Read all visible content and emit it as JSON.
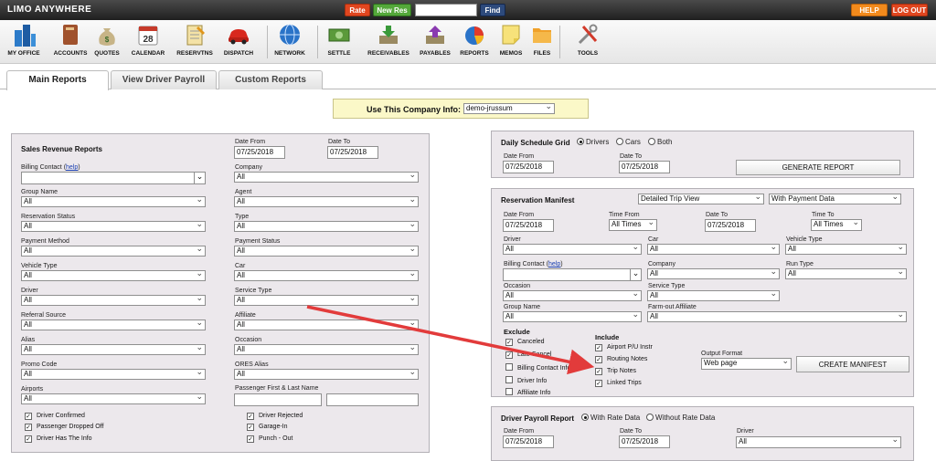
{
  "app": {
    "logo": "LIMO ANYWHERE"
  },
  "topbar": {
    "rate": "Rate",
    "new_res": "New Res",
    "search_value": "",
    "find": "Find",
    "help": "HELP",
    "logout": "LOG OUT"
  },
  "iconbar": [
    {
      "key": "my-office",
      "label": "MY OFFICE",
      "icon": "buildings-icon"
    },
    {
      "key": "accounts",
      "label": "ACCOUNTS",
      "icon": "binder-icon"
    },
    {
      "key": "quotes",
      "label": "QUOTES",
      "icon": "money-bag-icon"
    },
    {
      "key": "calendar",
      "label": "CALENDAR",
      "icon": "calendar-icon"
    },
    {
      "key": "reservtns",
      "label": "RESERVTNS",
      "icon": "notepad-icon"
    },
    {
      "key": "dispatch",
      "label": "DISPATCH",
      "icon": "red-car-icon"
    },
    {
      "key": "network",
      "label": "NETWORK",
      "icon": "globe-icon"
    },
    {
      "key": "settle",
      "label": "SETTLE",
      "icon": "cash-icon"
    },
    {
      "key": "receivables",
      "label": "RECEIVABLES",
      "icon": "inbox-arrow-icon"
    },
    {
      "key": "payables",
      "label": "PAYABLES",
      "icon": "outbox-arrow-icon"
    },
    {
      "key": "reports",
      "label": "REPORTS",
      "icon": "pie-chart-icon"
    },
    {
      "key": "memos",
      "label": "MEMOS",
      "icon": "sticky-note-icon"
    },
    {
      "key": "files",
      "label": "FILES",
      "icon": "folder-icon"
    },
    {
      "key": "tools",
      "label": "TOOLS",
      "icon": "tools-icon"
    }
  ],
  "tabs": [
    "Main Reports",
    "View Driver Payroll",
    "Custom Reports"
  ],
  "company": {
    "label": "Use This Company Info:",
    "value": "demo-jrussum"
  },
  "sales": {
    "title": "Sales Revenue Reports",
    "date_from_label": "Date From",
    "date_from": "07/25/2018",
    "date_to_label": "Date To",
    "date_to": "07/25/2018",
    "billing_label": "Billing Contact",
    "billing_help": "help",
    "billing_value": "",
    "left_fields": [
      {
        "label": "Group Name",
        "value": "All"
      },
      {
        "label": "Reservation Status",
        "value": "All"
      },
      {
        "label": "Payment Method",
        "value": "All"
      },
      {
        "label": "Vehicle Type",
        "value": "All"
      },
      {
        "label": "Driver",
        "value": "All"
      },
      {
        "label": "Referral Source",
        "value": "All"
      },
      {
        "label": "Alias",
        "value": "All"
      },
      {
        "label": "Promo Code",
        "value": "All"
      },
      {
        "label": "Airports",
        "value": "All"
      }
    ],
    "right_fields": [
      {
        "label": "Company",
        "value": "All"
      },
      {
        "label": "Agent",
        "value": "All"
      },
      {
        "label": "Type",
        "value": "All"
      },
      {
        "label": "Payment Status",
        "value": "All"
      },
      {
        "label": "Car",
        "value": "All"
      },
      {
        "label": "Service Type",
        "value": "All"
      },
      {
        "label": "Affiliate",
        "value": "All"
      },
      {
        "label": "Occasion",
        "value": "All"
      },
      {
        "label": "ORES Alias",
        "value": "All"
      }
    ],
    "passenger_label": "Passenger First & Last Name",
    "checks_left": [
      "Driver Confirmed",
      "Passenger Dropped Off",
      "Driver Has The Info"
    ],
    "checks_right": [
      "Driver Rejected",
      "Garage-In",
      "Punch - Out"
    ]
  },
  "daily": {
    "title": "Daily Schedule Grid",
    "radios": [
      "Drivers",
      "Cars",
      "Both"
    ],
    "date_from_label": "Date From",
    "date_from": "07/25/2018",
    "date_to_label": "Date To",
    "date_to": "07/25/2018",
    "button": "GENERATE REPORT"
  },
  "manifest": {
    "title": "Reservation Manifest",
    "view": "Detailed Trip View",
    "payment": "With Payment Data",
    "date_from_label": "Date From",
    "date_from": "07/25/2018",
    "time_from_label": "Time From",
    "time_from": "All Times",
    "date_to_label": "Date To",
    "date_to": "07/25/2018",
    "time_to_label": "Time To",
    "time_to": "All Times",
    "driver_label": "Driver",
    "driver": "All",
    "car_label": "Car",
    "car": "All",
    "vehicle_type_label": "Vehicle Type",
    "vehicle_type": "All",
    "billing_label": "Billing Contact",
    "billing_help": "help",
    "billing_value": "",
    "company_label": "Company",
    "company": "All",
    "run_type_label": "Run Type",
    "run_type": "All",
    "occasion_label": "Occasion",
    "occasion": "All",
    "service_type_label": "Service Type",
    "service_type": "All",
    "group_label": "Group Name",
    "group": "All",
    "farmout_label": "Farm-out Affiliate",
    "farmout": "All",
    "exclude_title": "Exclude",
    "exclude": [
      {
        "label": "Canceled",
        "checked": true
      },
      {
        "label": "Late Cancel",
        "checked": true
      },
      {
        "label": "Billing Contact Info",
        "checked": false
      },
      {
        "label": "Driver Info",
        "checked": false
      },
      {
        "label": "Affiliate Info",
        "checked": false
      }
    ],
    "include_title": "Include",
    "include": [
      {
        "label": "Airport P/U Instr",
        "checked": true
      },
      {
        "label": "Routing Notes",
        "checked": true
      },
      {
        "label": "Trip Notes",
        "checked": true
      },
      {
        "label": "Linked Trips",
        "checked": true
      }
    ],
    "output_label": "Output Format",
    "output": "Web page",
    "button": "CREATE MANIFEST"
  },
  "payroll": {
    "title": "Driver Payroll Report",
    "radios": [
      "With Rate Data",
      "Without Rate Data"
    ],
    "date_from_label": "Date From",
    "date_from": "07/25/2018",
    "date_to_label": "Date To",
    "date_to": "07/25/2018",
    "driver_label": "Driver",
    "driver": "All"
  },
  "colors": {
    "rate_btn": "#e0461f",
    "new_res_btn": "#54a83a",
    "find_btn": "#2d4a7c",
    "help_btn": "#f28a1c",
    "logout_btn": "#e0461f",
    "panel_bg": "#ece8ec",
    "company_bg": "#fbf8c8",
    "annotation_arrow": "#e23b3b"
  }
}
